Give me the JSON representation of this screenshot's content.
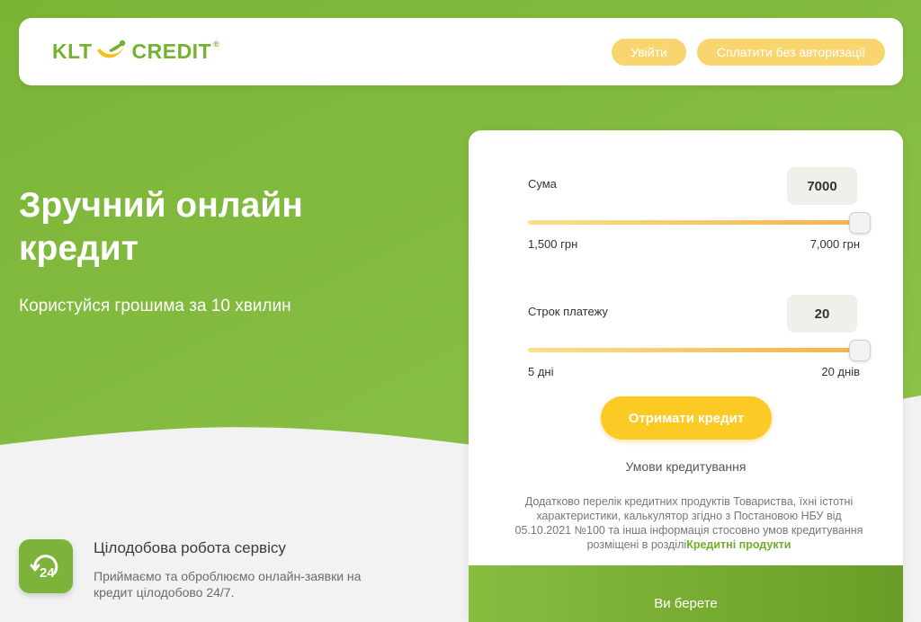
{
  "header": {
    "logo_left": "KLT",
    "logo_right": "CREDIT",
    "logo_mark": "®",
    "login_label": "Увійти",
    "pay_label": "Сплатити без авторизації"
  },
  "hero": {
    "title": "Зручний онлайн кредит",
    "subtitle": "Користуйся грошима за 10 хвилин"
  },
  "feature": {
    "icon": "24h-clock-icon",
    "title": "Цілодобова робота сервісу",
    "text": "Приймаємо та оброблюємо онлайн-заявки на кредит цілодобово 24/7."
  },
  "calculator": {
    "amount": {
      "label": "Сума",
      "value": "7000",
      "min_label": "1,500 грн",
      "max_label": "7,000 грн",
      "fraction": 1.0
    },
    "term": {
      "label": "Строк платежу",
      "value": "20",
      "min_label": "5 дні",
      "max_label": "20 днів",
      "fraction": 1.0
    },
    "submit_label": "Отримати кредит",
    "terms_link": "Умови кредитування",
    "disclaimer": "Додатково перелік кредитних продуктів Товариства, їхні істотні характеристики, калькулятор згідно з Постановою НБУ від 05.10.2021 №100 та інша інформація стосовно умов кредитування розміщені в розділі",
    "disclaimer_link": "Кредитні продукти",
    "footer_label": "Ви берете"
  },
  "colors": {
    "brand_green": "#72b32e",
    "accent_yellow": "#fbca24",
    "pill_yellow": "#f8d56f"
  }
}
